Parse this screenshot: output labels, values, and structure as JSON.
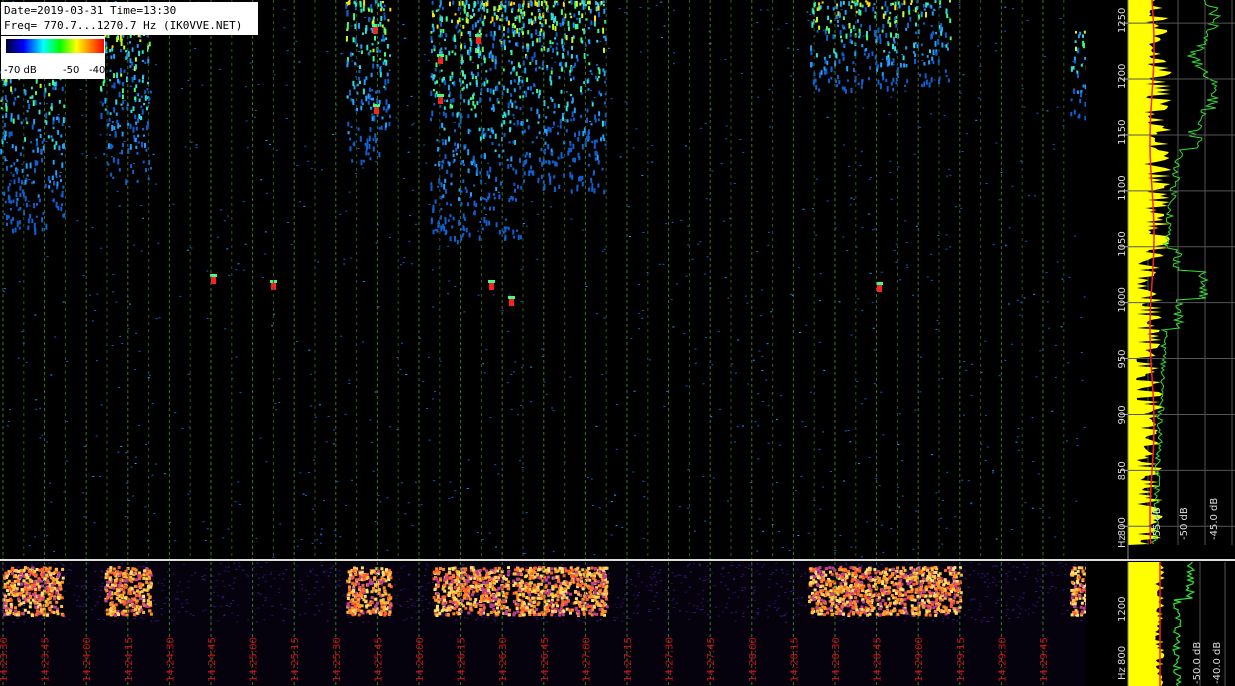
{
  "header": {
    "date_line": "Date=2019-03-31 Time=13:30",
    "freq_line": "Freq= 770.7...1270.7 Hz (IK0VVE.NET)"
  },
  "colorbar": {
    "min_label": "-70 dB",
    "mid_label": "-50",
    "max_label": "-40"
  },
  "colors": {
    "background": "#000000",
    "grid_time": "#3a7a2a",
    "time_label": "#cc1111",
    "spectrum_fill": "#ffff00",
    "spectrum_line": "#33dd33",
    "marker": "#ff2222"
  },
  "chart_data": [
    {
      "type": "heatmap",
      "title": "",
      "xlabel": "",
      "ylabel": "Hz",
      "ylim": [
        770.7,
        1270.7
      ],
      "y_ticks": [
        "800",
        "850",
        "900",
        "950",
        "1000",
        "1050",
        "1100",
        "1150",
        "1200",
        "1250"
      ],
      "colorbar_range_db": [
        -70,
        -40
      ]
    },
    {
      "type": "line",
      "title": "",
      "xlabel": "",
      "ylabel": "",
      "x_ticks": [
        "-55 dB",
        "-50 dB",
        "-45.0 dB"
      ],
      "series": [],
      "grid": true
    },
    {
      "type": "heatmap",
      "title": "",
      "xlabel": "",
      "ylabel": "Hz",
      "x_ticks": [
        "14:23:30",
        "14:23:45",
        "14:24:00",
        "14:24:15",
        "14:24:30",
        "14:24:45",
        "14:25:00",
        "14:25:15",
        "14:25:30",
        "14:25:45",
        "14:26:00",
        "14:26:15",
        "14:26:30",
        "14:26:45",
        "14:27:00",
        "14:27:15",
        "14:27:30",
        "14:27:45",
        "14:28:00",
        "14:28:15",
        "14:28:30",
        "14:28:45",
        "14:29:00",
        "14:29:15",
        "14:29:30",
        "14:29:45"
      ],
      "y_ticks": [
        "800",
        "1200"
      ]
    },
    {
      "type": "line",
      "title": "",
      "xlabel": "",
      "ylabel": "",
      "x_ticks": [
        "-50.0 dB",
        "-40.0 dB"
      ],
      "series": [],
      "grid": true
    }
  ]
}
